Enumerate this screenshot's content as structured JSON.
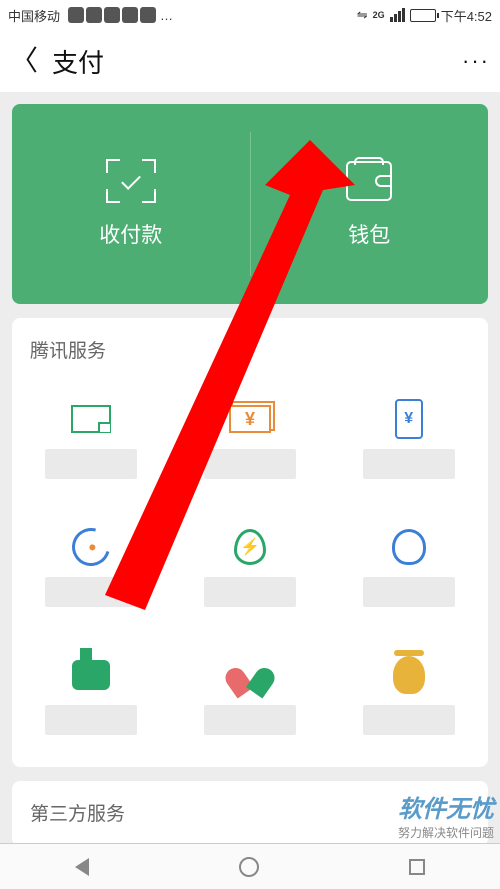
{
  "status_bar": {
    "carrier": "中国移动",
    "network_type": "2G",
    "time": "下午4:52",
    "more_indicator": "…"
  },
  "title_bar": {
    "title": "支付",
    "more_label": "···"
  },
  "green_card": {
    "pay_receive_label": "收付款",
    "wallet_label": "钱包"
  },
  "sections": {
    "tencent_services_header": "腾讯服务",
    "third_party_header": "第三方服务"
  },
  "watermark": {
    "brand": "软件无忧",
    "slogan": "努力解决软件问题"
  }
}
